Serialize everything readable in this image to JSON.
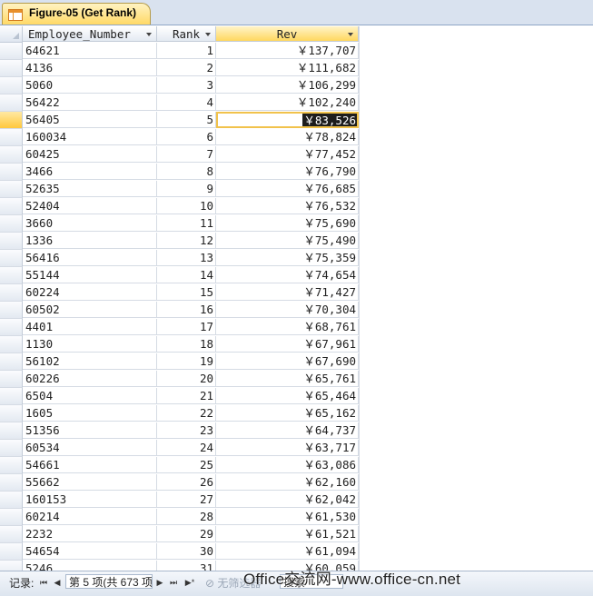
{
  "tab": {
    "title": "Figure-05 (Get Rank)"
  },
  "columns": [
    "Employee_Number",
    "Rank",
    "Rev"
  ],
  "rows": [
    [
      "64621",
      "1",
      "￥137,707"
    ],
    [
      "4136",
      "2",
      "￥111,682"
    ],
    [
      "5060",
      "3",
      "￥106,299"
    ],
    [
      "56422",
      "4",
      "￥102,240"
    ],
    [
      "56405",
      "5",
      "￥83,526"
    ],
    [
      "160034",
      "6",
      "￥78,824"
    ],
    [
      "60425",
      "7",
      "￥77,452"
    ],
    [
      "3466",
      "8",
      "￥76,790"
    ],
    [
      "52635",
      "9",
      "￥76,685"
    ],
    [
      "52404",
      "10",
      "￥76,532"
    ],
    [
      "3660",
      "11",
      "￥75,690"
    ],
    [
      "1336",
      "12",
      "￥75,490"
    ],
    [
      "56416",
      "13",
      "￥75,359"
    ],
    [
      "55144",
      "14",
      "￥74,654"
    ],
    [
      "60224",
      "15",
      "￥71,427"
    ],
    [
      "60502",
      "16",
      "￥70,304"
    ],
    [
      "4401",
      "17",
      "￥68,761"
    ],
    [
      "1130",
      "18",
      "￥67,961"
    ],
    [
      "56102",
      "19",
      "￥67,690"
    ],
    [
      "60226",
      "20",
      "￥65,761"
    ],
    [
      "6504",
      "21",
      "￥65,464"
    ],
    [
      "1605",
      "22",
      "￥65,162"
    ],
    [
      "51356",
      "23",
      "￥64,737"
    ],
    [
      "60534",
      "24",
      "￥63,717"
    ],
    [
      "54661",
      "25",
      "￥63,086"
    ],
    [
      "55662",
      "26",
      "￥62,160"
    ],
    [
      "160153",
      "27",
      "￥62,042"
    ],
    [
      "60214",
      "28",
      "￥61,530"
    ],
    [
      "2232",
      "29",
      "￥61,521"
    ],
    [
      "54654",
      "30",
      "￥61,094"
    ],
    [
      "5246",
      "31",
      "￥60,059"
    ]
  ],
  "current_row": 5,
  "nav": {
    "label": "记录:",
    "first": "⏮",
    "prev": "◀",
    "record": "第 5 项(共 673 项)",
    "next": "▶",
    "last": "⏭",
    "new": "▶*",
    "filter": "无筛选器",
    "search": "搜索"
  },
  "watermark": "Office交流网-www.office-cn.net"
}
